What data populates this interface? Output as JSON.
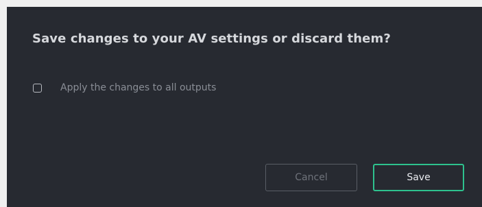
{
  "dialog": {
    "title": "Save changes to your AV settings or discard them?",
    "option": {
      "label": "Apply the changes to all outputs",
      "checked": false
    },
    "buttons": {
      "cancel_label": "Cancel",
      "save_label": "Save"
    },
    "colors": {
      "background": "#272a31",
      "accent": "#2ec28e"
    }
  }
}
